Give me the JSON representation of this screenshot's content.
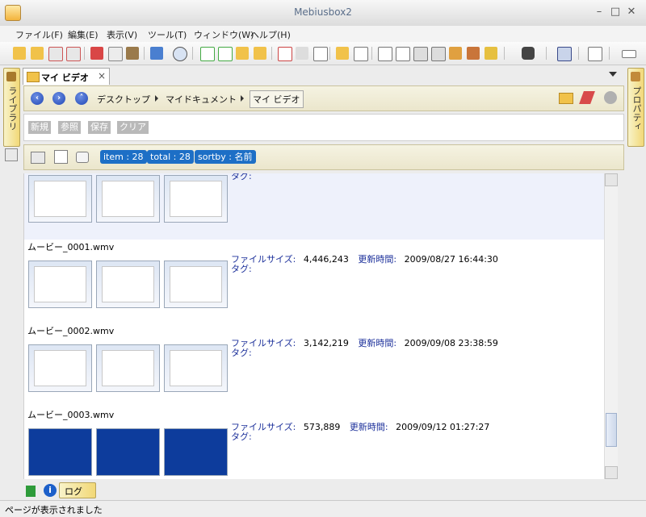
{
  "window": {
    "title": "Mebiusbox2"
  },
  "menu": [
    "ファイル(F)",
    "編集(E)",
    "表示(V)",
    "ツール(T)",
    "ウィンドウ(W)",
    "ヘルプ(H)"
  ],
  "left_panel": {
    "label": "ライブラリ"
  },
  "right_panel": {
    "label": "プロパティ"
  },
  "tab": {
    "label": "マイ ビデオ",
    "close": "×"
  },
  "breadcrumb": [
    "デスクトップ",
    "マイドキュメント",
    "マイ ビデオ"
  ],
  "search_buttons": [
    "新規",
    "参照",
    "保存",
    "クリア"
  ],
  "info": {
    "item": "item : 28",
    "total": "total : 28",
    "sortby": "sortby : 名前"
  },
  "labels": {
    "size": "ファイルサイズ:",
    "updated": "更新時間:",
    "tags": "タグ:"
  },
  "items": [
    {
      "name": "",
      "size": "",
      "updated": "",
      "thumbs": "white"
    },
    {
      "name": "ムービー_0001.wmv",
      "size": "4,446,243",
      "updated": "2009/08/27 16:44:30",
      "thumbs": "white"
    },
    {
      "name": "ムービー_0002.wmv",
      "size": "3,142,219",
      "updated": "2009/09/08 23:38:59",
      "thumbs": "white"
    },
    {
      "name": "ムービー_0003.wmv",
      "size": "573,889",
      "updated": "2009/09/12 01:27:27",
      "thumbs": "blue"
    }
  ],
  "log_panel": {
    "label": "ログ"
  },
  "status": {
    "text": "ページが表示されました"
  },
  "scroll_position": 0.92
}
